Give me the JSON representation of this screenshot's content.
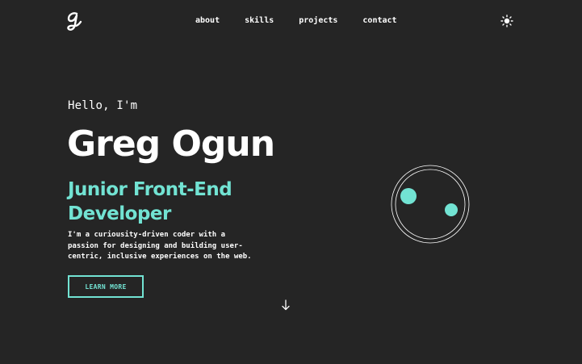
{
  "header": {
    "logo_icon": "cursive-g-logo-icon",
    "nav": [
      {
        "label": "about"
      },
      {
        "label": "skills"
      },
      {
        "label": "projects"
      },
      {
        "label": "contact"
      }
    ],
    "theme_toggle_icon": "sun-icon"
  },
  "hero": {
    "greeting": "Hello, I'm",
    "name": "Greg Ogun",
    "role": "Junior Front-End Developer",
    "bio": "I'm a curiousity-driven coder with a passion for designing and building user-centric, inclusive experiences on the web.",
    "cta_label": "LEARN MORE",
    "scroll_icon": "arrow-down-icon"
  },
  "decoration": {
    "orbit_icon": "orbit-circles-icon"
  },
  "colors": {
    "background": "#252525",
    "accent": "#72e3d3",
    "text": "#ffffff"
  }
}
